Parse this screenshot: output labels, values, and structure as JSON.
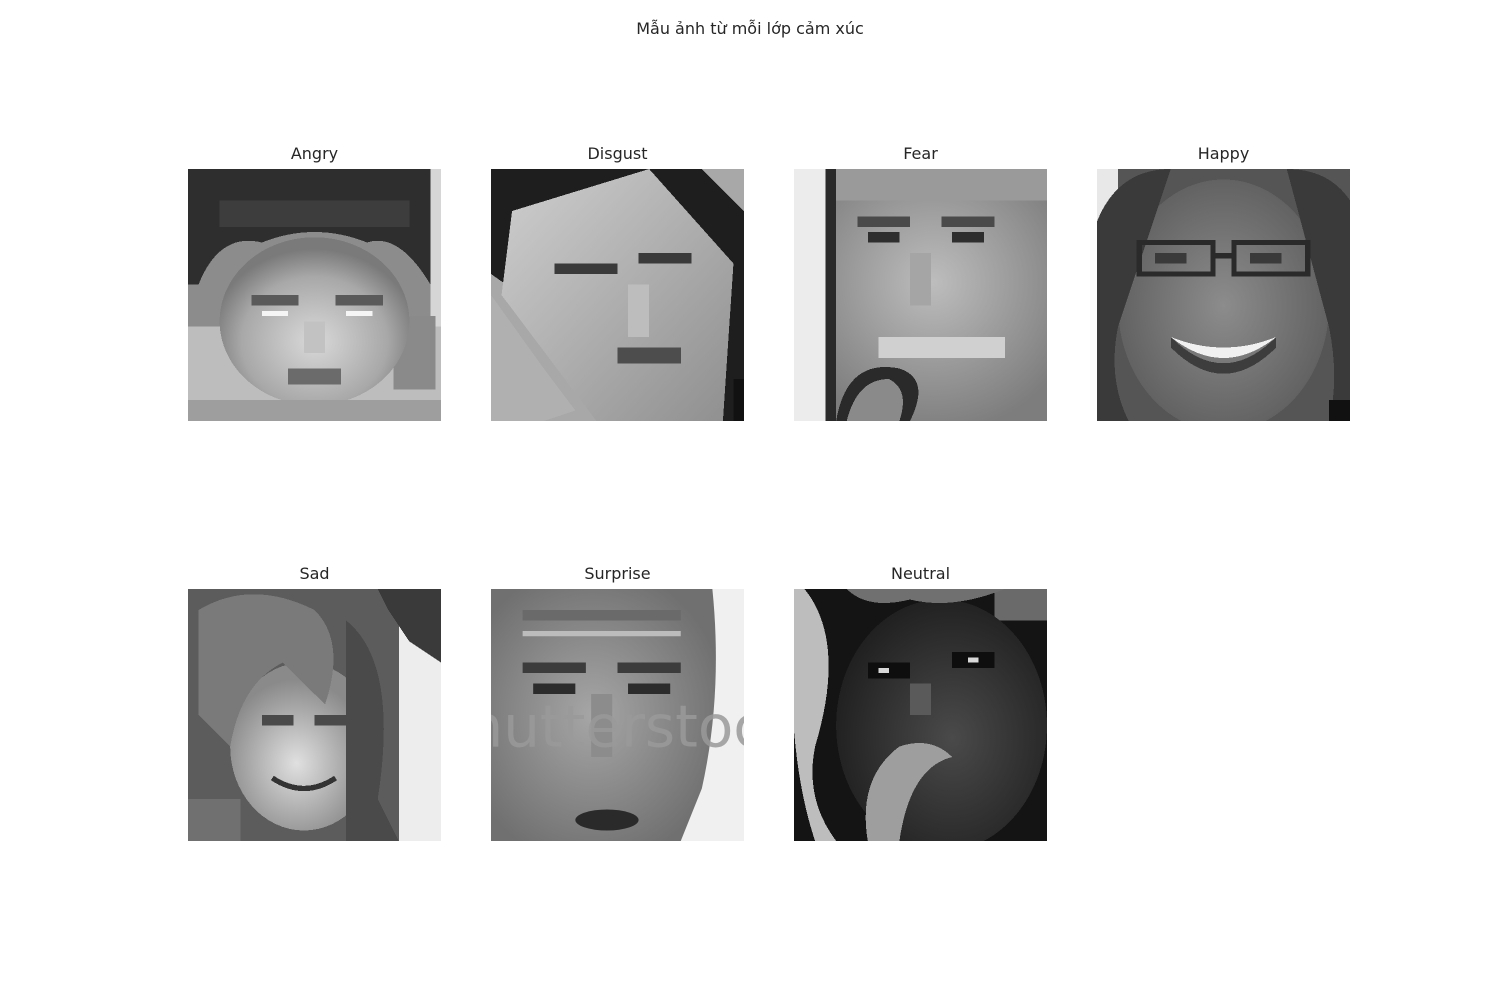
{
  "figure": {
    "title": "Mẫu ảnh từ mỗi lớp cảm xúc"
  },
  "panels": [
    {
      "label": "Angry"
    },
    {
      "label": "Disgust"
    },
    {
      "label": "Fear"
    },
    {
      "label": "Happy"
    },
    {
      "label": "Sad"
    },
    {
      "label": "Surprise"
    },
    {
      "label": "Neutral"
    }
  ],
  "watermark": "shutterstock",
  "colormap": "grayscale"
}
